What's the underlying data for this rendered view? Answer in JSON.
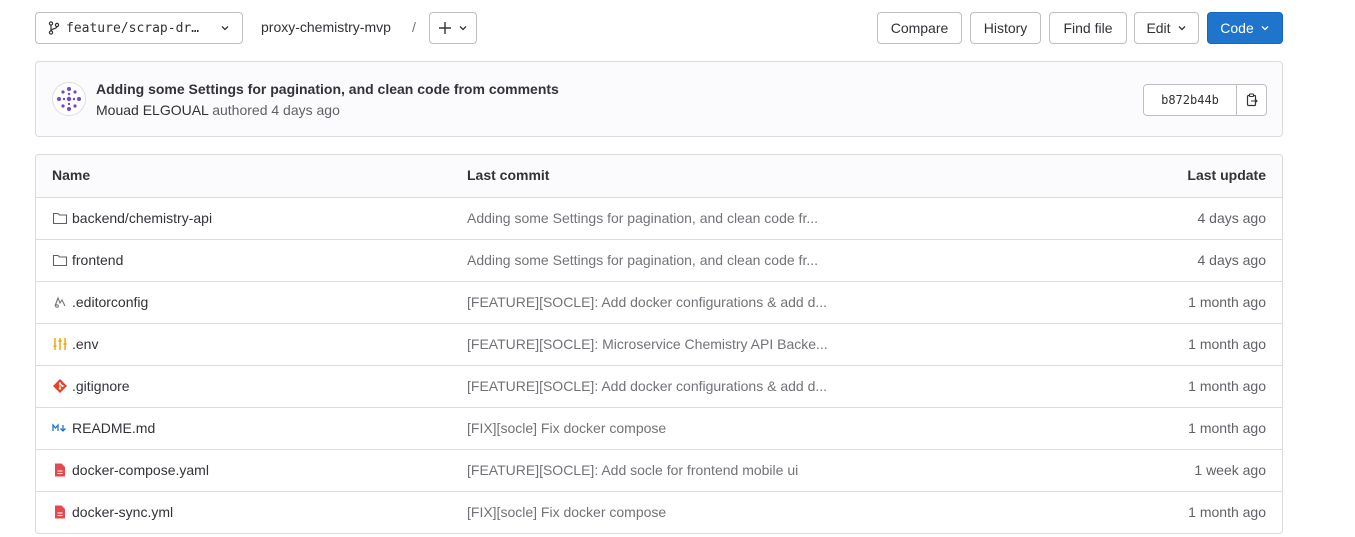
{
  "toolbar": {
    "branch": "feature/scrap-dr…",
    "repo": "proxy-chemistry-mvp",
    "separator": "/",
    "compare": "Compare",
    "history": "History",
    "find_file": "Find file",
    "edit": "Edit",
    "code": "Code"
  },
  "commit": {
    "title": "Adding some Settings for pagination, and clean code from comments",
    "author": "Mouad ELGOUAL",
    "meta": "authored 4 days ago",
    "sha": "b872b44b"
  },
  "table": {
    "headers": {
      "name": "Name",
      "last_commit": "Last commit",
      "last_update": "Last update"
    },
    "rows": [
      {
        "icon": "folder-icon",
        "name": "backend/chemistry-api",
        "commit": "Adding some Settings for pagination, and clean code fr...",
        "updated": "4 days ago"
      },
      {
        "icon": "folder-icon",
        "name": "frontend",
        "commit": "Adding some Settings for pagination, and clean code fr...",
        "updated": "4 days ago"
      },
      {
        "icon": "editorconfig-icon",
        "name": ".editorconfig",
        "commit": "[FEATURE][SOCLE]: Add docker configurations & add d...",
        "updated": "1 month ago"
      },
      {
        "icon": "env-icon",
        "name": ".env",
        "commit": "[FEATURE][SOCLE]: Microservice Chemistry API Backe...",
        "updated": "1 month ago"
      },
      {
        "icon": "git-icon",
        "name": ".gitignore",
        "commit": "[FEATURE][SOCLE]: Add docker configurations & add d...",
        "updated": "1 month ago"
      },
      {
        "icon": "markdown-icon",
        "name": "README.md",
        "commit": "[FIX][socle] Fix docker compose",
        "updated": "1 month ago"
      },
      {
        "icon": "file-red-icon",
        "name": "docker-compose.yaml",
        "commit": "[FEATURE][SOCLE]: Add socle for frontend mobile ui",
        "updated": "1 week ago"
      },
      {
        "icon": "file-red-icon",
        "name": "docker-sync.yml",
        "commit": "[FIX][socle] Fix docker compose",
        "updated": "1 month ago"
      }
    ]
  },
  "colors": {
    "primary": "#1f75cb",
    "border": "#dcdcde",
    "muted": "#737278"
  }
}
